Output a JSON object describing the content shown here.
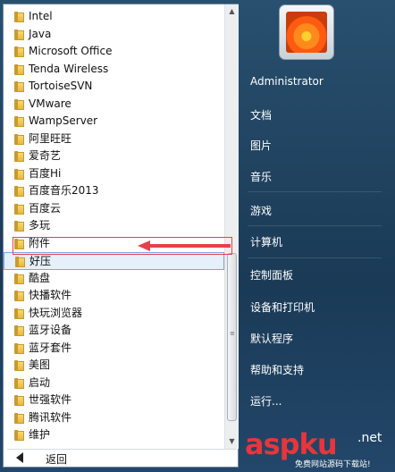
{
  "programs": {
    "items": [
      {
        "label": "Intel"
      },
      {
        "label": "Java"
      },
      {
        "label": "Microsoft Office"
      },
      {
        "label": "Tenda Wireless"
      },
      {
        "label": "TortoiseSVN"
      },
      {
        "label": "VMware"
      },
      {
        "label": "WampServer"
      },
      {
        "label": "阿里旺旺"
      },
      {
        "label": "爱奇艺"
      },
      {
        "label": "百度Hi"
      },
      {
        "label": "百度音乐2013"
      },
      {
        "label": "百度云"
      },
      {
        "label": "多玩"
      },
      {
        "label": "附件"
      },
      {
        "label": "好压"
      },
      {
        "label": "酷盘"
      },
      {
        "label": "快播软件"
      },
      {
        "label": "快玩浏览器"
      },
      {
        "label": "蓝牙设备"
      },
      {
        "label": "蓝牙套件"
      },
      {
        "label": "美图"
      },
      {
        "label": "启动"
      },
      {
        "label": "世强软件"
      },
      {
        "label": "腾讯软件"
      },
      {
        "label": "维护"
      }
    ],
    "back_label": "返回"
  },
  "right_panel": {
    "user": "Administrator",
    "items": [
      {
        "label": "文档"
      },
      {
        "label": "图片"
      },
      {
        "label": "音乐"
      },
      {
        "label": "游戏"
      },
      {
        "label": "计算机"
      },
      {
        "label": "控制面板"
      },
      {
        "label": "设备和打印机"
      },
      {
        "label": "默认程序"
      },
      {
        "label": "帮助和支持"
      },
      {
        "label": "运行..."
      }
    ]
  },
  "watermark": {
    "brand": "aspku",
    "suffix": ".net",
    "subtitle": "免费网站源码下载站!"
  },
  "colors": {
    "annotation": "#e6414a",
    "hover_bg": "#e5f0fb"
  }
}
